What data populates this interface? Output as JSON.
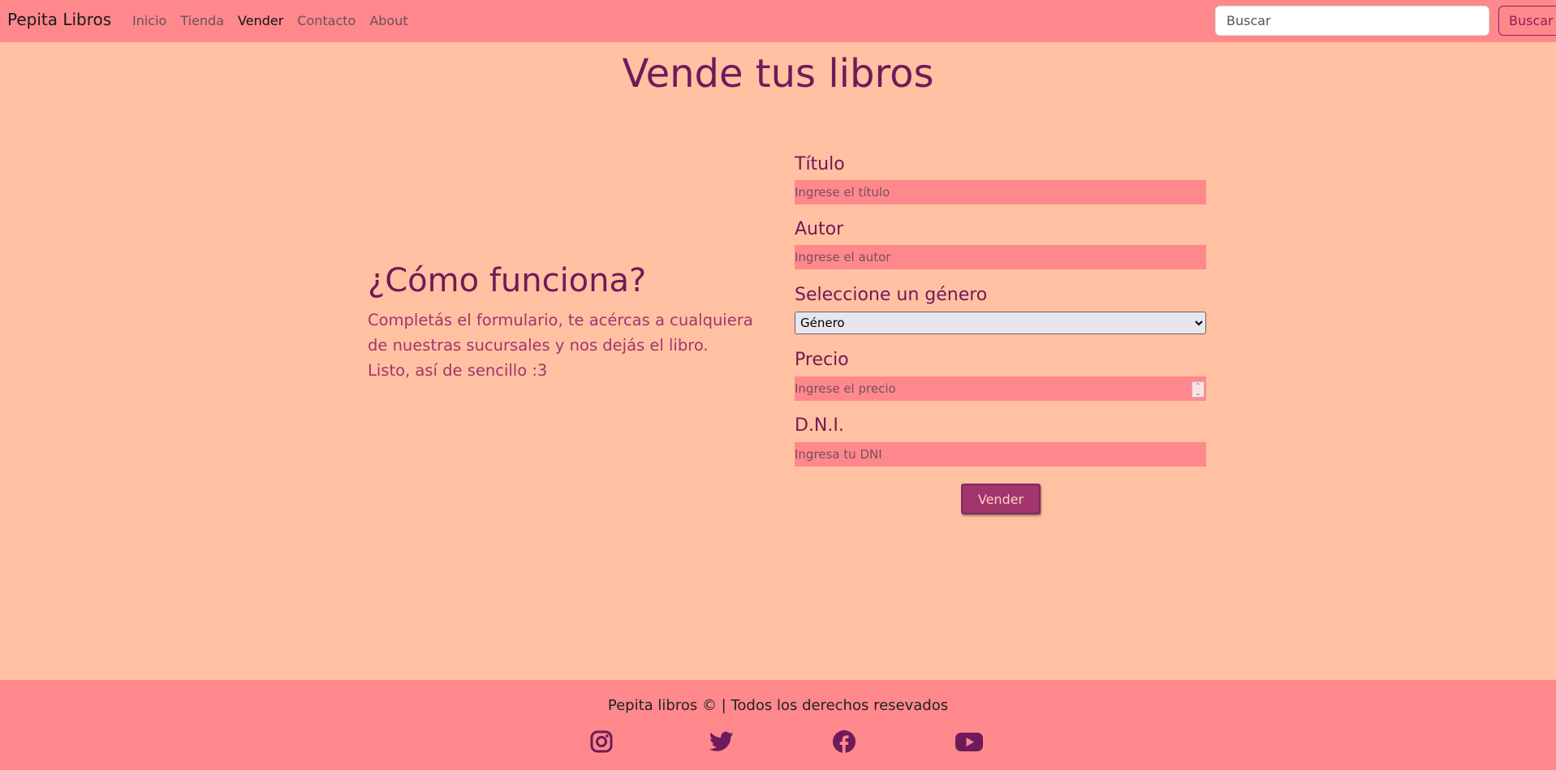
{
  "navbar": {
    "brand": "Pepita Libros",
    "links": [
      {
        "label": "Inicio"
      },
      {
        "label": "Tienda"
      },
      {
        "label": "Vender"
      },
      {
        "label": "Contacto"
      },
      {
        "label": "About"
      }
    ],
    "active_link": "Vender",
    "search": {
      "placeholder": "Buscar",
      "button_label": "Buscar"
    }
  },
  "main": {
    "title": "Vende tus libros",
    "how_it_works": {
      "title": "¿Cómo funciona?",
      "line1": "Completás el formulario, te acércas a cualquiera de nuestras sucursales y nos dejás el libro.",
      "line2": "Listo, así de sencillo :3"
    },
    "form": {
      "titulo": {
        "label": "Título",
        "placeholder": "Ingrese el título"
      },
      "autor": {
        "label": "Autor",
        "placeholder": "Ingrese el autor"
      },
      "genero": {
        "label": "Seleccione un género",
        "selected": "Género"
      },
      "precio": {
        "label": "Precio",
        "placeholder": "Ingrese el precio"
      },
      "dni": {
        "label": "D.N.I.",
        "placeholder": "Ingresa tu DNI"
      },
      "submit_label": "Vender"
    }
  },
  "footer": {
    "text": "Pepita libros © | Todos los derechos resevados",
    "social": [
      "instagram-icon",
      "twitter-icon",
      "facebook-icon",
      "youtube-icon"
    ]
  },
  "colors": {
    "page_bg": "#ffc1a1",
    "navbar_bg": "#ff888d",
    "primary": "#6f1a5a",
    "accent": "#a2346e"
  }
}
